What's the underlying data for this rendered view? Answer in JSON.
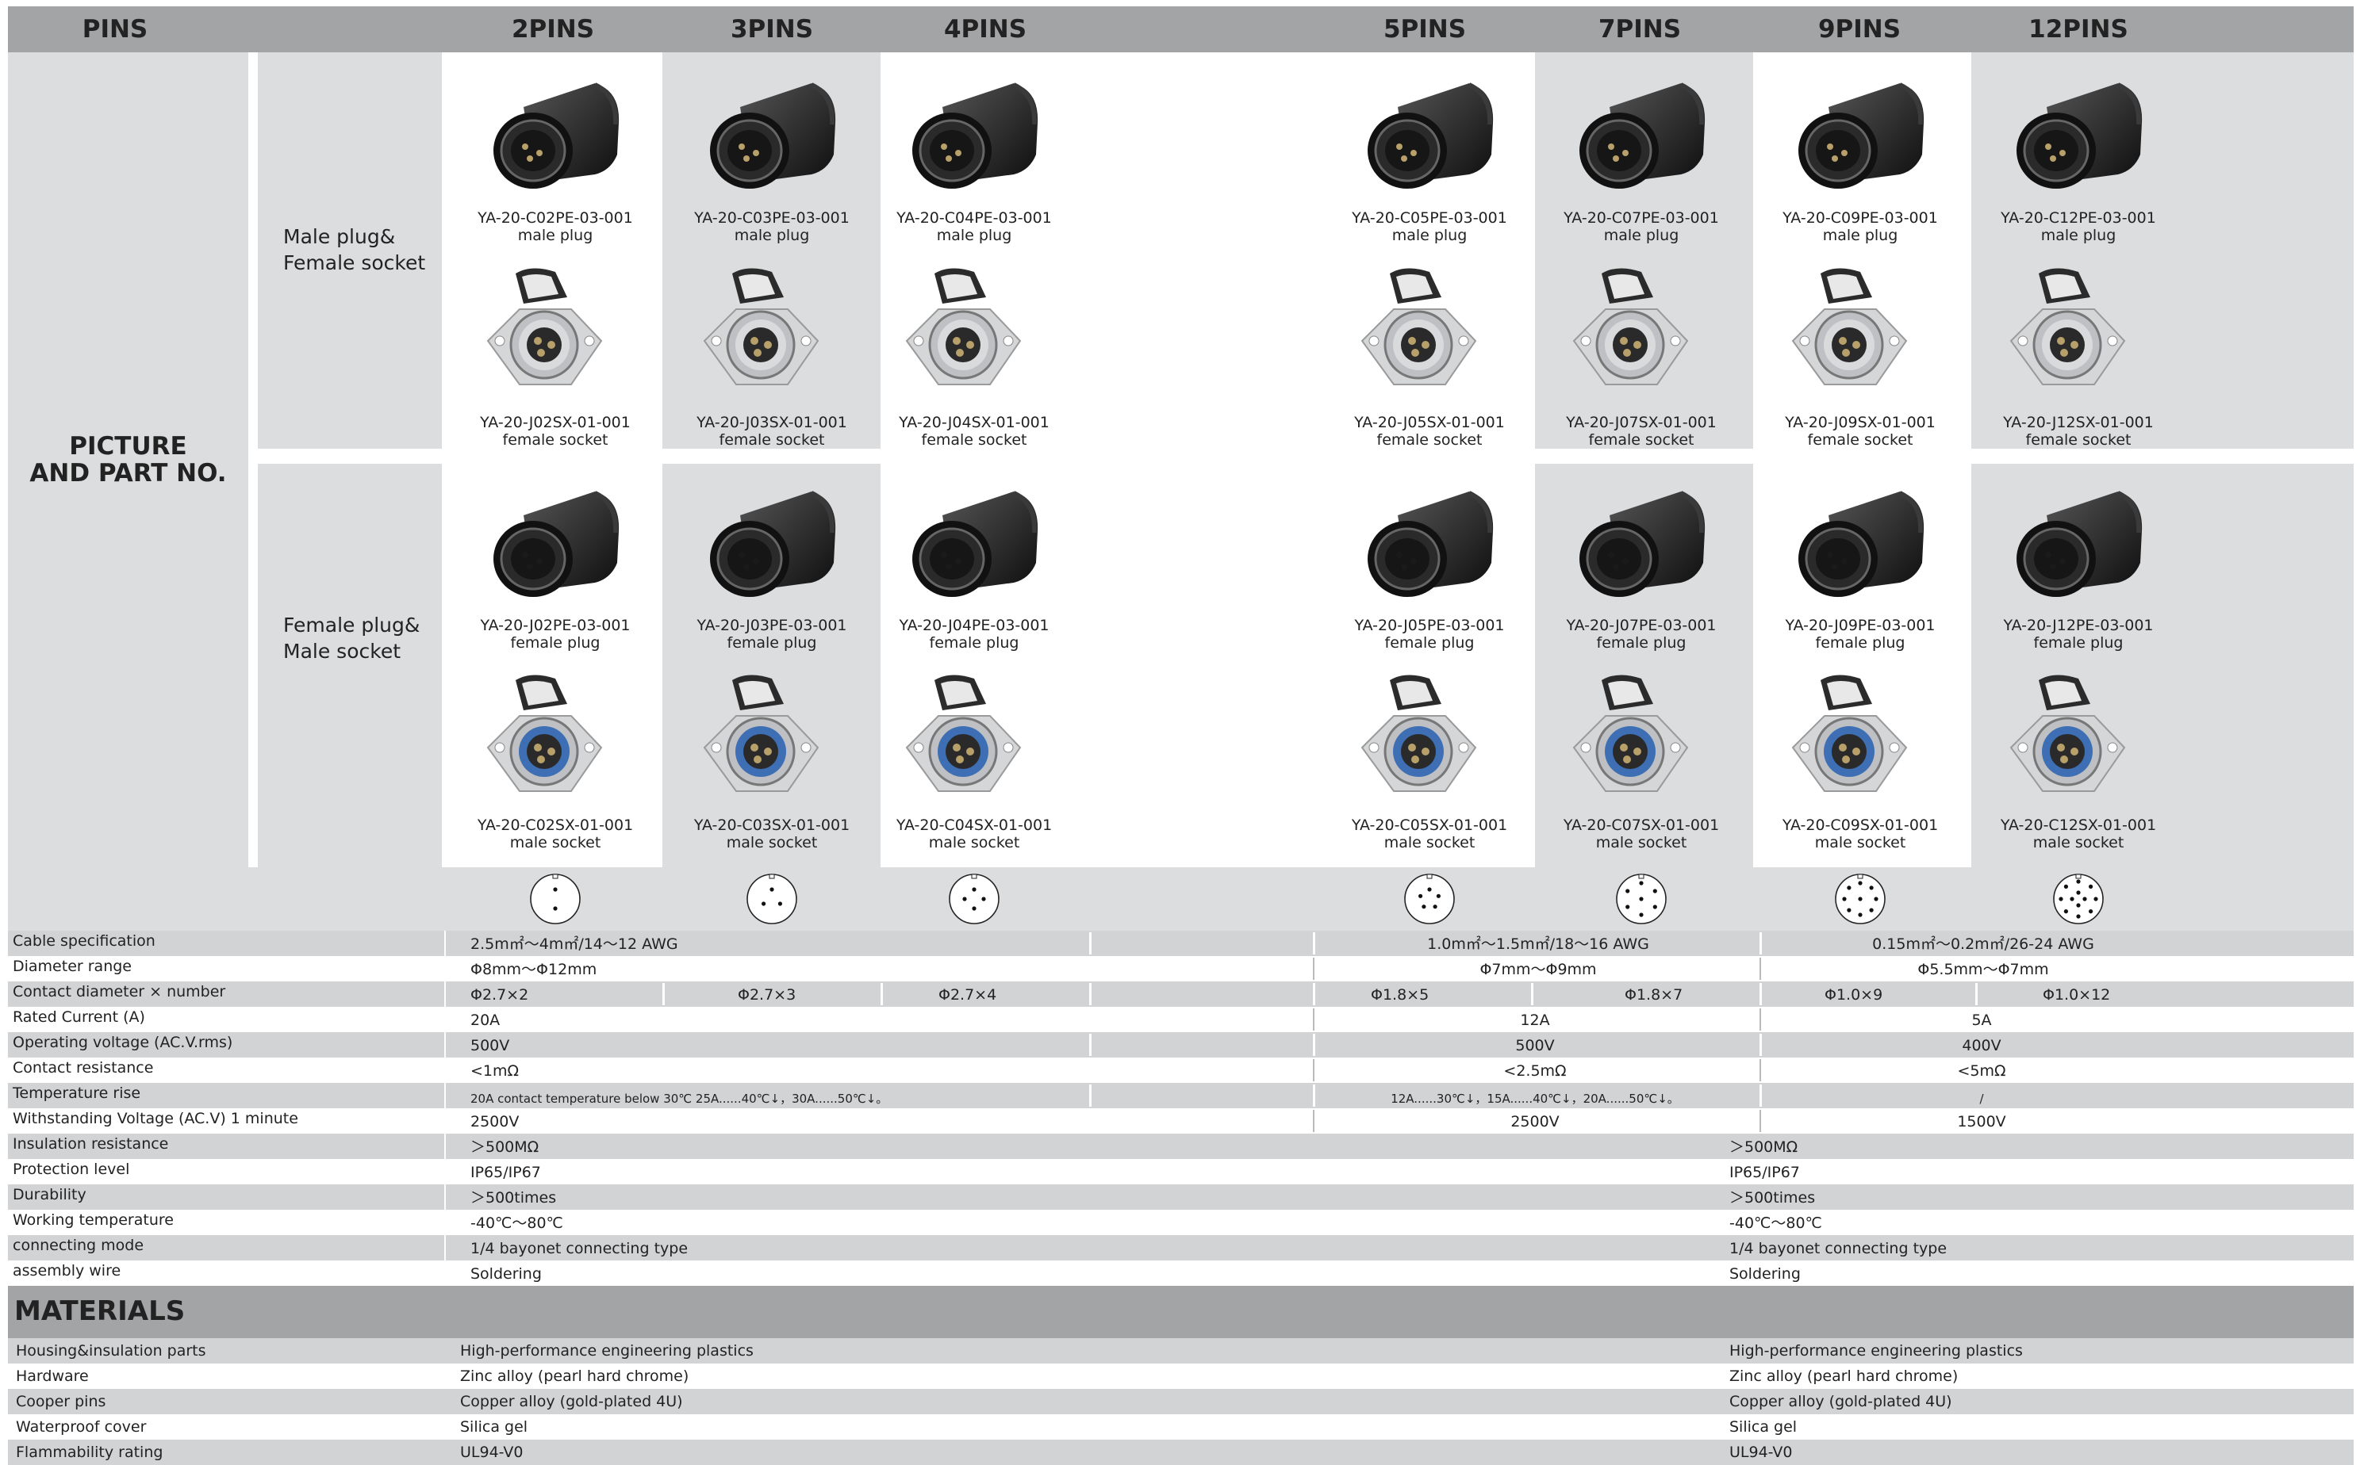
{
  "header": {
    "pins_label": "PINS",
    "columns": [
      "2PINS",
      "3PINS",
      "4PINS",
      "5PINS",
      "7PINS",
      "9PINS",
      "12PINS"
    ]
  },
  "section_label": "PICTURE\nAND PART NO.",
  "row_groups": [
    {
      "label": "Male plug&\nFemale socket"
    },
    {
      "label": "Female plug&\nMale socket"
    }
  ],
  "parts": {
    "top_plug": [
      {
        "code": "YA-20-C02PE-03-001",
        "desc": "male plug"
      },
      {
        "code": "YA-20-C03PE-03-001",
        "desc": "male plug"
      },
      {
        "code": "YA-20-C04PE-03-001",
        "desc": "male plug"
      },
      {
        "code": "YA-20-C05PE-03-001",
        "desc": "male plug"
      },
      {
        "code": "YA-20-C07PE-03-001",
        "desc": "male plug"
      },
      {
        "code": "YA-20-C09PE-03-001",
        "desc": "male plug"
      },
      {
        "code": "YA-20-C12PE-03-001",
        "desc": "male plug"
      }
    ],
    "top_socket": [
      {
        "code": "YA-20-J02SX-01-001",
        "desc": "female socket"
      },
      {
        "code": "YA-20-J03SX-01-001",
        "desc": "female socket"
      },
      {
        "code": "YA-20-J04SX-01-001",
        "desc": "female socket"
      },
      {
        "code": "YA-20-J05SX-01-001",
        "desc": "female socket"
      },
      {
        "code": "YA-20-J07SX-01-001",
        "desc": "female socket"
      },
      {
        "code": "YA-20-J09SX-01-001",
        "desc": "female socket"
      },
      {
        "code": "YA-20-J12SX-01-001",
        "desc": "female socket"
      }
    ],
    "bottom_plug": [
      {
        "code": "YA-20-J02PE-03-001",
        "desc": "female plug"
      },
      {
        "code": "YA-20-J03PE-03-001",
        "desc": "female plug"
      },
      {
        "code": "YA-20-J04PE-03-001",
        "desc": "female plug"
      },
      {
        "code": "YA-20-J05PE-03-001",
        "desc": "female plug"
      },
      {
        "code": "YA-20-J07PE-03-001",
        "desc": "female plug"
      },
      {
        "code": "YA-20-J09PE-03-001",
        "desc": "female plug"
      },
      {
        "code": "YA-20-J12PE-03-001",
        "desc": "female plug"
      }
    ],
    "bottom_socket": [
      {
        "code": "YA-20-C02SX-01-001",
        "desc": "male socket"
      },
      {
        "code": "YA-20-C03SX-01-001",
        "desc": "male socket"
      },
      {
        "code": "YA-20-C04SX-01-001",
        "desc": "male socket"
      },
      {
        "code": "YA-20-C05SX-01-001",
        "desc": "male socket"
      },
      {
        "code": "YA-20-C07SX-01-001",
        "desc": "male socket"
      },
      {
        "code": "YA-20-C09SX-01-001",
        "desc": "male socket"
      },
      {
        "code": "YA-20-C12SX-01-001",
        "desc": "male socket"
      }
    ]
  },
  "specs": [
    {
      "label": "Cable specification",
      "g1": "2.5m㎡～4m㎡/14～12 AWG",
      "g2": "1.0m㎡～1.5m㎡/18～16 AWG",
      "g3": "0.15m㎡～0.2m㎡/26-24 AWG"
    },
    {
      "label": "Diameter range",
      "g1": "Φ8mm～Φ12mm",
      "g2": "Φ7mm～Φ9mm",
      "g3": "Φ5.5mm～Φ7mm"
    },
    {
      "label": "Contact diameter × number",
      "c2": "Φ2.7×2",
      "c3": "Φ2.7×3",
      "c4": "Φ2.7×4",
      "c5": "Φ1.8×5",
      "c7": "Φ1.8×7",
      "c9": "Φ1.0×9",
      "c12": "Φ1.0×12"
    },
    {
      "label": "Rated Current (A)",
      "g1": "20A",
      "g2": "12A",
      "g3": "5A"
    },
    {
      "label": "Operating voltage (AC.V.rms)",
      "g1": "500V",
      "g2": "500V",
      "g3": "400V"
    },
    {
      "label": "Contact resistance",
      "g1": "<1mΩ",
      "g2": "<2.5mΩ",
      "g3": "<5mΩ"
    },
    {
      "label": "Temperature rise",
      "g1": "20A contact temperature below 30℃  25A......40℃↓，30A......50℃↓。",
      "g2": "12A......30℃↓，15A......40℃↓，20A......50℃↓。",
      "g3": "/"
    },
    {
      "label": "Withstanding Voltage (AC.V) 1 minute",
      "g1": "2500V",
      "g2": "2500V",
      "g3": "1500V"
    },
    {
      "label": "Insulation resistance",
      "l": "＞500MΩ",
      "r": "＞500MΩ"
    },
    {
      "label": "Protection level",
      "l": "IP65/IP67",
      "r": "IP65/IP67"
    },
    {
      "label": "Durability",
      "l": "＞500times",
      "r": "＞500times"
    },
    {
      "label": "Working temperature",
      "l": "-40℃～80℃",
      "r": "-40℃～80℃"
    },
    {
      "label": "connecting mode",
      "l": "1/4 bayonet connecting type",
      "r": "1/4 bayonet connecting type"
    },
    {
      "label": "assembly wire",
      "l": "Soldering",
      "r": "Soldering"
    }
  ],
  "materials": {
    "title": "MATERIALS",
    "rows": [
      {
        "label": "Housing&insulation parts",
        "l": "High-performance engineering plastics",
        "r": "High-performance engineering plastics"
      },
      {
        "label": "Hardware",
        "l": "Zinc alloy (pearl hard chrome)",
        "r": "Zinc alloy (pearl hard chrome)"
      },
      {
        "label": "Cooper pins",
        "l": "Copper alloy (gold-plated 4U)",
        "r": "Copper alloy (gold-plated 4U)"
      },
      {
        "label": "Waterproof cover",
        "l": "Silica gel",
        "r": "Silica gel"
      },
      {
        "label": "Flammability rating",
        "l": "UL94-V0",
        "r": "UL94-V0"
      }
    ]
  }
}
